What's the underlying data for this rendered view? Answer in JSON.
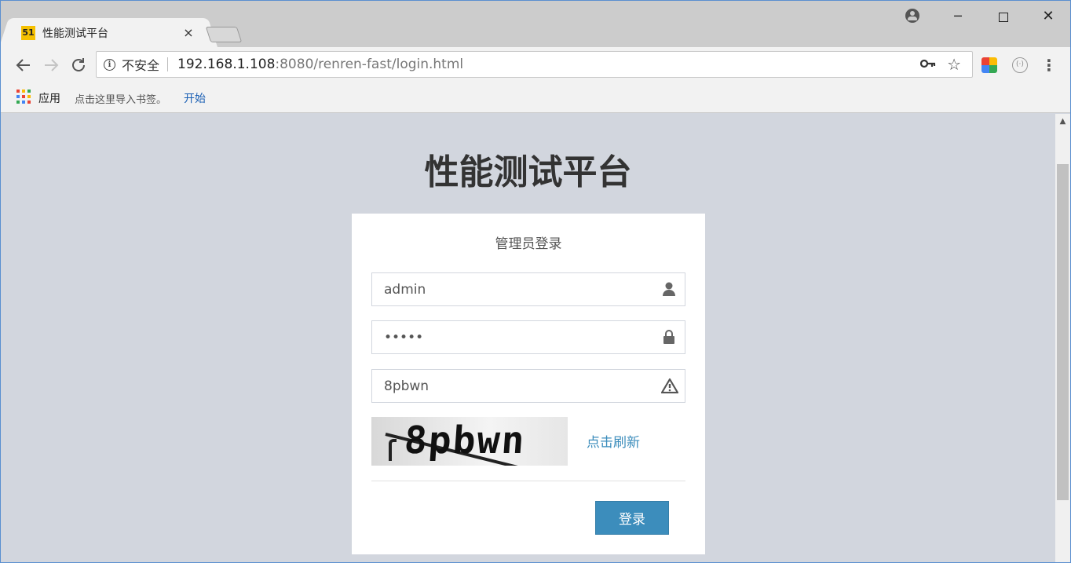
{
  "browser": {
    "tab": {
      "favicon_text": "51",
      "title": "性能测试平台",
      "close": "×"
    },
    "window_controls": {
      "minimize": "─",
      "close": "✕"
    },
    "address_bar": {
      "security_label": "不安全",
      "url_host": "192.168.1.108",
      "url_rest": ":8080/renren-fast/login.html"
    },
    "bookmarks": {
      "apps_label": "应用",
      "hint": "点击这里导入书签。",
      "start_link": "开始"
    }
  },
  "page": {
    "title": "性能测试平台",
    "login": {
      "heading": "管理员登录",
      "username": {
        "value": "admin"
      },
      "password": {
        "value": "admin"
      },
      "captcha": {
        "value": "8pbwn",
        "image_text": "8pbwn"
      },
      "refresh_label": "点击刷新",
      "submit_label": "登录"
    }
  },
  "colors": {
    "background": "#d2d6de",
    "primary_button": "#3c8dbc",
    "link": "#3c8dbc"
  },
  "icons": {
    "username_field": "user-icon",
    "password_field": "lock-icon",
    "captcha_field": "warning-icon"
  }
}
